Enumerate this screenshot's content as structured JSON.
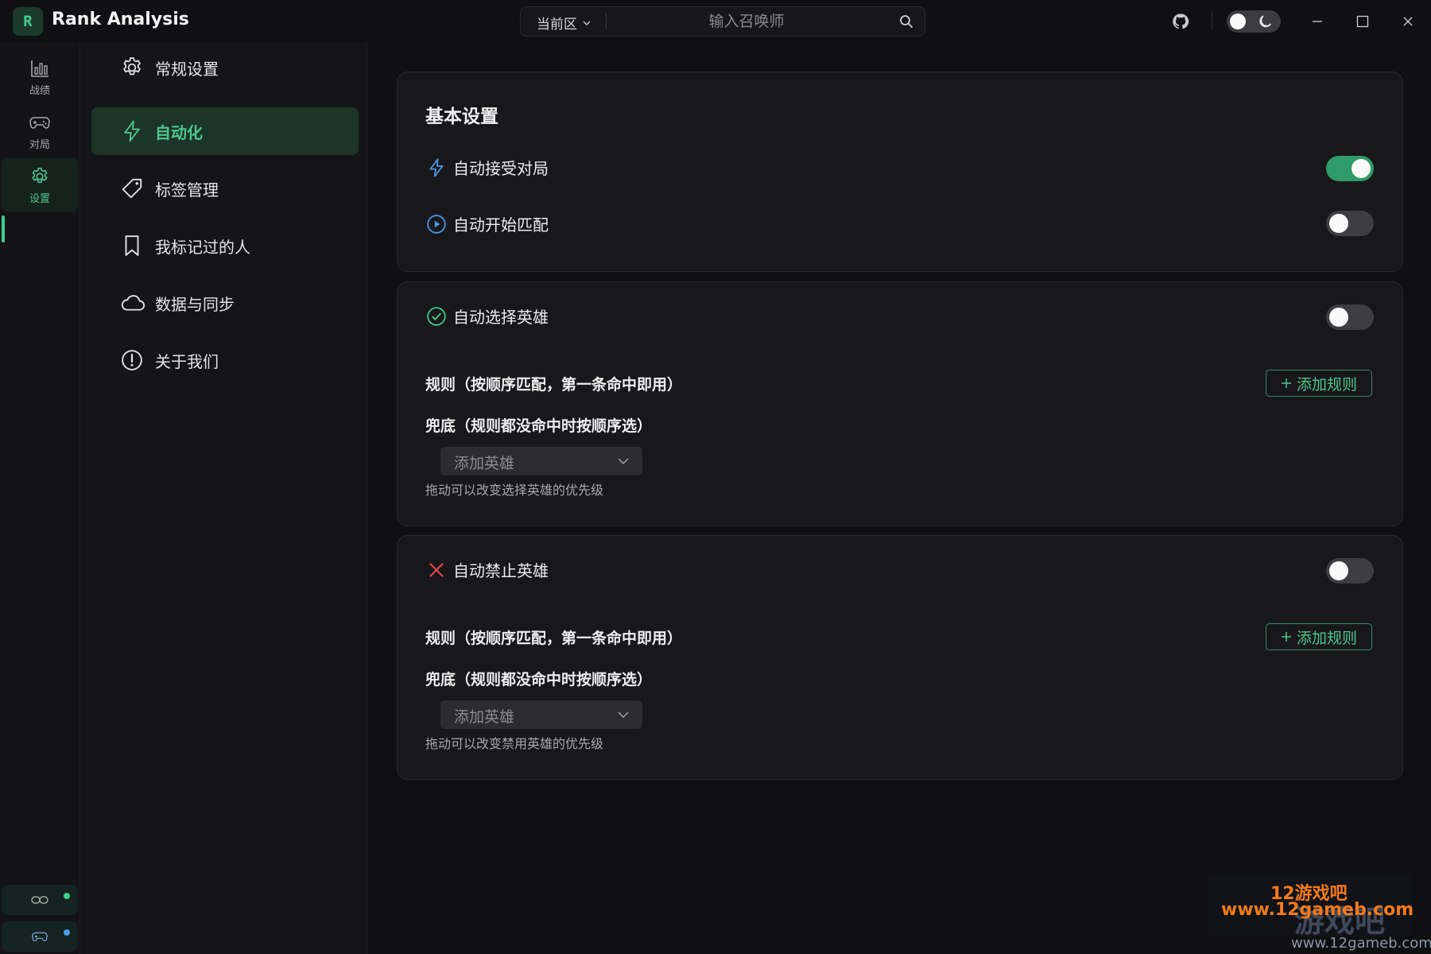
{
  "app": {
    "logo_letter": "R",
    "title": "Rank Analysis"
  },
  "search": {
    "region": "当前区",
    "placeholder": "输入召唤师"
  },
  "colors": {
    "accent": "#3fcf8e",
    "toggle_on": "#2f9b68",
    "danger": "#e0464f",
    "info": "#4a9ce8"
  },
  "rail": {
    "items": [
      {
        "label": "战绩",
        "icon": "bar-chart-icon"
      },
      {
        "label": "对局",
        "icon": "gamepad-icon"
      },
      {
        "label": "设置",
        "icon": "gear-icon"
      }
    ]
  },
  "subnav": {
    "items": [
      {
        "label": "常规设置",
        "icon": "gear-icon"
      },
      {
        "label": "自动化",
        "icon": "lightning-icon"
      },
      {
        "label": "标签管理",
        "icon": "tag-icon"
      },
      {
        "label": "我标记过的人",
        "icon": "bookmark-icon"
      },
      {
        "label": "数据与同步",
        "icon": "cloud-icon"
      },
      {
        "label": "关于我们",
        "icon": "info-icon"
      }
    ],
    "active_index": 1
  },
  "basic": {
    "title": "基本设置",
    "auto_accept": {
      "label": "自动接受对局",
      "enabled": true
    },
    "auto_match": {
      "label": "自动开始匹配",
      "enabled": false
    }
  },
  "auto_pick": {
    "label": "自动选择英雄",
    "enabled": false,
    "rules_label": "规则（按顺序匹配，第一条命中即用）",
    "add_rule": "添加规则",
    "fallback_label": "兜底（规则都没命中时按顺序选）",
    "select_placeholder": "添加英雄",
    "hint": "拖动可以改变选择英雄的优先级"
  },
  "auto_ban": {
    "label": "自动禁止英雄",
    "enabled": false,
    "rules_label": "规则（按顺序匹配，第一条命中即用）",
    "add_rule": "添加规则",
    "fallback_label": "兜底（规则都没命中时按顺序选）",
    "select_placeholder": "添加英雄",
    "hint": "拖动可以改变禁用英雄的优先级"
  },
  "watermark": {
    "line1": "12游戏吧",
    "line2": "www.12gameb.com",
    "big": "游戏吧",
    "line3": "www.12gameb.com"
  }
}
